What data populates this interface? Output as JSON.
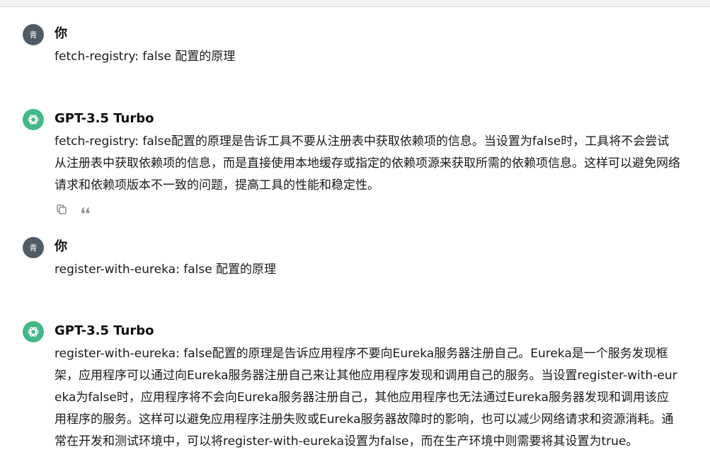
{
  "conversation": [
    {
      "role": "user",
      "author": "你",
      "avatar_text": "青",
      "text": "fetch-registry: false 配置的原理"
    },
    {
      "role": "assistant",
      "author": "GPT-3.5 Turbo",
      "text": "fetch-registry: false配置的原理是告诉工具不要从注册表中获取依赖项的信息。当设置为false时，工具将不会尝试从注册表中获取依赖项的信息，而是直接使用本地缓存或指定的依赖项源来获取所需的依赖项信息。这样可以避免网络请求和依赖项版本不一致的问题，提高工具的性能和稳定性。",
      "actions": [
        "copy-icon",
        "quote-icon"
      ]
    },
    {
      "role": "user",
      "author": "你",
      "avatar_text": "青",
      "text": "register-with-eureka: false 配置的原理"
    },
    {
      "role": "assistant",
      "author": "GPT-3.5 Turbo",
      "text": "register-with-eureka: false配置的原理是告诉应用程序不要向Eureka服务器注册自己。Eureka是一个服务发现框架，应用程序可以通过向Eureka服务器注册自己来让其他应用程序发现和调用自己的服务。当设置register-with-eureka为false时，应用程序将不会向Eureka服务器注册自己，其他应用程序也无法通过Eureka服务器发现和调用该应用程序的服务。这样可以避免应用程序注册失败或Eureka服务器故障时的影响，也可以减少网络请求和资源消耗。通常在开发和测试环境中，可以将register-with-eureka设置为false，而在生产环境中则需要将其设置为true。"
    }
  ],
  "colors": {
    "user_avatar": "#4f5b66",
    "gpt_avatar": "#43b889"
  }
}
